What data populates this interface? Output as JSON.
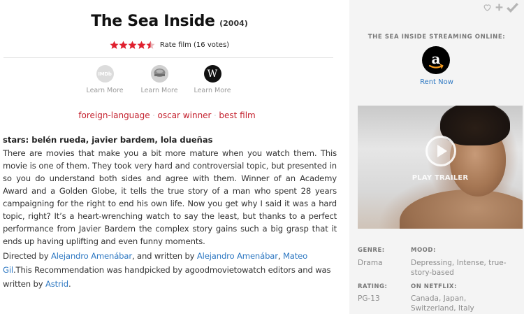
{
  "movie": {
    "title": "The Sea Inside",
    "year": "(2004)",
    "rating": 4.5,
    "rate_text": "Rate film (16 votes)"
  },
  "external_links": [
    {
      "label": "Learn More",
      "icon": "imdb-icon"
    },
    {
      "label": "Learn More",
      "icon": "rotten-tomatoes-icon"
    },
    {
      "label": "Learn More",
      "icon": "wikipedia-icon"
    }
  ],
  "tags": [
    "foreign-language",
    "oscar winner",
    "best film"
  ],
  "tag_separator": "·",
  "stars_line": "stars: belén rueda, javier bardem, lola dueñas",
  "review": "There are movies that make you a bit more mature when you watch them. This movie is one of them. They took very hard and controversial topic, but presented in so you do understand both sides and agree with them. Winner of an Academy Award and a Golden Globe, it tells the true story of a man who spent 28 years campaigning for the right to end his own life. Now you get why I said it was a hard topic, right? It’s a heart-wrenching watch to say the least, but thanks to a perfect performance from Javier Bardem the complex story gains such a big grasp that it ends up having uplifting and even funny moments.",
  "credits": {
    "directed_by": "Directed by ",
    "director": "Alejandro Amenábar",
    "written_by": ", and written by ",
    "writer1": "Alejandro Amenábar",
    "comma": ", ",
    "writer2": "Mateo Gil",
    "handpicked": ".This Recommendation was handpicked by agoodmovietowatch editors and was written by ",
    "author": "Astrid",
    "end": "."
  },
  "sidebar": {
    "streaming_heading": "THE SEA INSIDE STREAMING ONLINE:",
    "provider_icon": "amazon-icon",
    "rent_label": "Rent Now",
    "trailer_label": "PLAY TRAILER",
    "genre_label": "GENRE:",
    "genre_value": "Drama",
    "mood_label": "MOOD:",
    "mood_value": "Depressing, Intense, true-story-based",
    "rating_label": "RATING:",
    "rating_value": "PG-13",
    "netflix_label": "ON NETFLIX:",
    "netflix_value": "Canada, Japan, Switzerland, Italy"
  },
  "colors": {
    "accent_red": "#c4212e",
    "star_red": "#e0202f",
    "link_blue": "#2e78c2"
  }
}
